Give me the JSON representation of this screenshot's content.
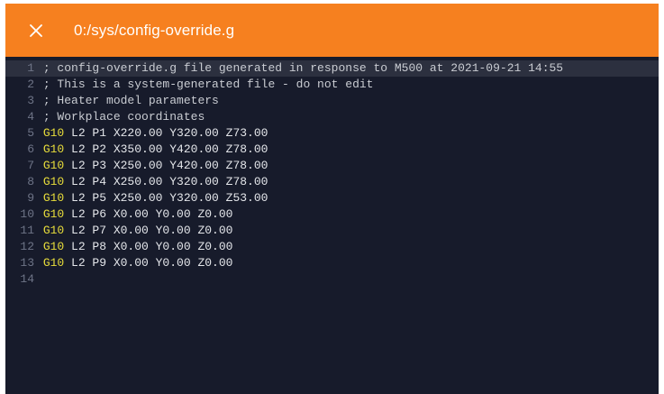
{
  "window": {
    "title": "0:/sys/config-override.g",
    "close_icon": "close-icon",
    "accent_color": "#f6801f",
    "editor_background": "#171b2b"
  },
  "editor": {
    "active_line": 1,
    "lines": [
      {
        "num": "1",
        "cmd": "",
        "rest": "; config-override.g file generated in response to M500 at 2021-09-21 14:55"
      },
      {
        "num": "2",
        "cmd": "",
        "rest": "; This is a system-generated file - do not edit"
      },
      {
        "num": "3",
        "cmd": "",
        "rest": "; Heater model parameters"
      },
      {
        "num": "4",
        "cmd": "",
        "rest": "; Workplace coordinates"
      },
      {
        "num": "5",
        "cmd": "G10",
        "rest": " L2 P1 X220.00 Y320.00 Z73.00"
      },
      {
        "num": "6",
        "cmd": "G10",
        "rest": " L2 P2 X350.00 Y420.00 Z78.00"
      },
      {
        "num": "7",
        "cmd": "G10",
        "rest": " L2 P3 X250.00 Y420.00 Z78.00"
      },
      {
        "num": "8",
        "cmd": "G10",
        "rest": " L2 P4 X250.00 Y320.00 Z78.00"
      },
      {
        "num": "9",
        "cmd": "G10",
        "rest": " L2 P5 X250.00 Y320.00 Z53.00"
      },
      {
        "num": "10",
        "cmd": "G10",
        "rest": " L2 P6 X0.00 Y0.00 Z0.00"
      },
      {
        "num": "11",
        "cmd": "G10",
        "rest": " L2 P7 X0.00 Y0.00 Z0.00"
      },
      {
        "num": "12",
        "cmd": "G10",
        "rest": " L2 P8 X0.00 Y0.00 Z0.00"
      },
      {
        "num": "13",
        "cmd": "G10",
        "rest": " L2 P9 X0.00 Y0.00 Z0.00"
      },
      {
        "num": "14",
        "cmd": "",
        "rest": ""
      }
    ]
  }
}
